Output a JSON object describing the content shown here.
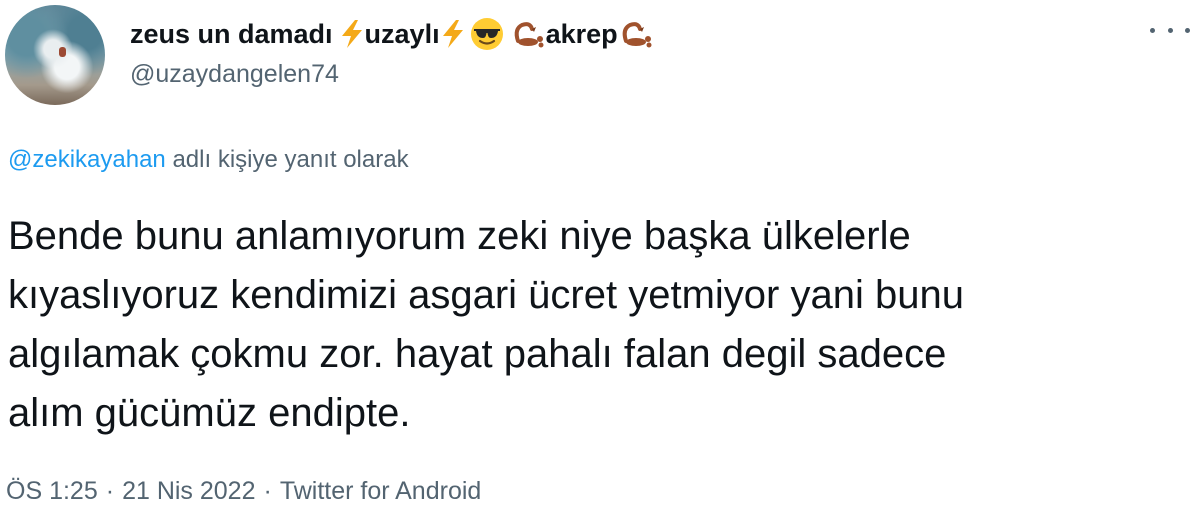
{
  "user": {
    "display_name": {
      "part1": "zeus un damadı",
      "part2": "uzaylı",
      "part3": "akrep"
    },
    "emojis": [
      "lightning-emoji",
      "lightning-emoji",
      "sunglasses-emoji",
      "scorpion-emoji",
      "scorpion-emoji"
    ],
    "handle": "@uzaydangelen74"
  },
  "reply": {
    "mention": "@zekikayahan",
    "suffix": "adlı kişiye yanıt olarak"
  },
  "tweet": {
    "lines": [
      "Bende bunu anlamıyorum zeki niye başka ülkelerle",
      "kıyaslıyoruz kendimizi asgari ücret yetmiyor yani bunu",
      "algılamak çokmu zor. hayat pahalı falan degil sadece",
      "alım gücümüz endipte."
    ]
  },
  "meta": {
    "time": "ÖS 1:25",
    "date": "21 Nis 2022",
    "source": "Twitter for Android",
    "separator": "·"
  },
  "colors": {
    "text_primary": "#0f1419",
    "text_secondary": "#536471",
    "link": "#1d9bf0"
  }
}
